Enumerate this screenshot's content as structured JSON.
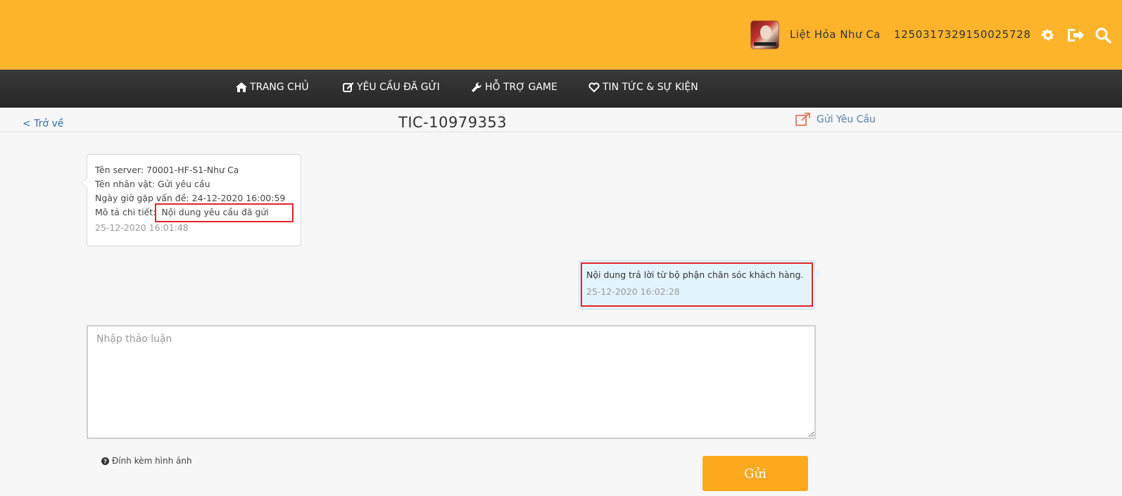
{
  "header": {
    "user_name": "Liệt Hỏa Như Ca",
    "user_id": "1250317329150025728",
    "icons": [
      "gear-icon",
      "logout-icon",
      "search-icon"
    ],
    "brand_color": "#fdb42b"
  },
  "nav": {
    "items": [
      {
        "label": "TRANG CHỦ",
        "icon": "home-icon"
      },
      {
        "label": "YÊU CẦU ĐÃ GỬI",
        "icon": "edit-icon"
      },
      {
        "label": "HỖ TRỢ GAME",
        "icon": "wrench-icon"
      },
      {
        "label": "TIN TỨC & SỰ KIỆN",
        "icon": "heart-icon"
      }
    ]
  },
  "titlebar": {
    "back_label": "< Trở về",
    "ticket_id": "TIC-10979353",
    "send_request_label": "Gửi Yêu Cầu"
  },
  "messages": {
    "user": {
      "server_line": "Tên server: 70001-HF-S1-Như Ca",
      "character_line": "Tên nhân vật: Gửi yêu cầu",
      "datetime_line": "Ngày giờ gặp vấn đề: 24-12-2020 16:00:59",
      "desc_label": "Mô tả chi tiết:",
      "desc_value": "Nội dung yêu cầu đã gửi",
      "timestamp": "25-12-2020 16:01:48"
    },
    "support": {
      "text": "Nội dung trả lời từ bộ phận chăn sóc khách hàng.",
      "timestamp": "25-12-2020 16:02:28"
    }
  },
  "composer": {
    "placeholder": "Nhập thảo luận",
    "value": "",
    "attach_label": "Đính kèm hình ảnh",
    "send_label": "Gửi"
  },
  "colors": {
    "highlight": "#e0242a",
    "send_button": "#fda91e",
    "link": "#2f6fb0"
  }
}
